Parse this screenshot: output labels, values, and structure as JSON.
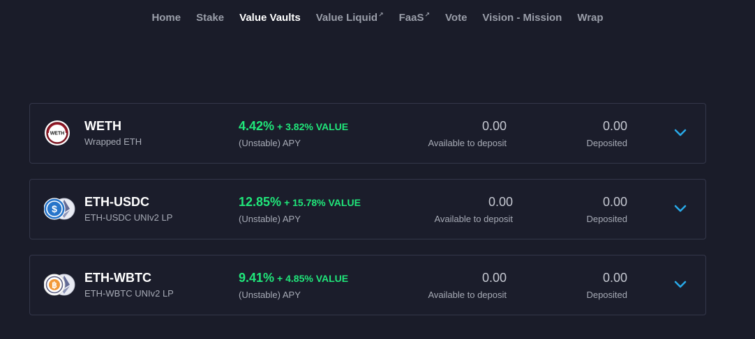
{
  "nav": [
    {
      "label": "Home",
      "external": false,
      "active": false
    },
    {
      "label": "Stake",
      "external": false,
      "active": false
    },
    {
      "label": "Value Vaults",
      "external": false,
      "active": true
    },
    {
      "label": "Value Liquid",
      "external": true,
      "active": false
    },
    {
      "label": "FaaS",
      "external": true,
      "active": false
    },
    {
      "label": "Vote",
      "external": false,
      "active": false
    },
    {
      "label": "Vision - Mission",
      "external": false,
      "active": false
    },
    {
      "label": "Wrap",
      "external": false,
      "active": false
    }
  ],
  "external_glyph": "↗",
  "vaults": [
    {
      "name": "WETH",
      "subtitle": "Wrapped ETH",
      "apy": "4.42%",
      "bonus": "+ 3.82% VALUE",
      "apy_label": "(Unstable) APY",
      "available": "0.00",
      "available_label": "Available to deposit",
      "deposited": "0.00",
      "deposited_label": "Deposited",
      "icon": "weth-icon",
      "icon_text": "WETH"
    },
    {
      "name": "ETH-USDC",
      "subtitle": "ETH-USDC UNIv2 LP",
      "apy": "12.85%",
      "bonus": "+ 15.78% VALUE",
      "apy_label": "(Unstable) APY",
      "available": "0.00",
      "available_label": "Available to deposit",
      "deposited": "0.00",
      "deposited_label": "Deposited",
      "icon": "usdc-eth-icon"
    },
    {
      "name": "ETH-WBTC",
      "subtitle": "ETH-WBTC UNIv2 LP",
      "apy": "9.41%",
      "bonus": "+ 4.85% VALUE",
      "apy_label": "(Unstable) APY",
      "available": "0.00",
      "available_label": "Available to deposit",
      "deposited": "0.00",
      "deposited_label": "Deposited",
      "icon": "wbtc-eth-icon"
    }
  ],
  "colors": {
    "background": "#1a1c29",
    "apy_green": "#20e67a",
    "chevron_blue": "#29a9e8",
    "border": "#34374a"
  }
}
